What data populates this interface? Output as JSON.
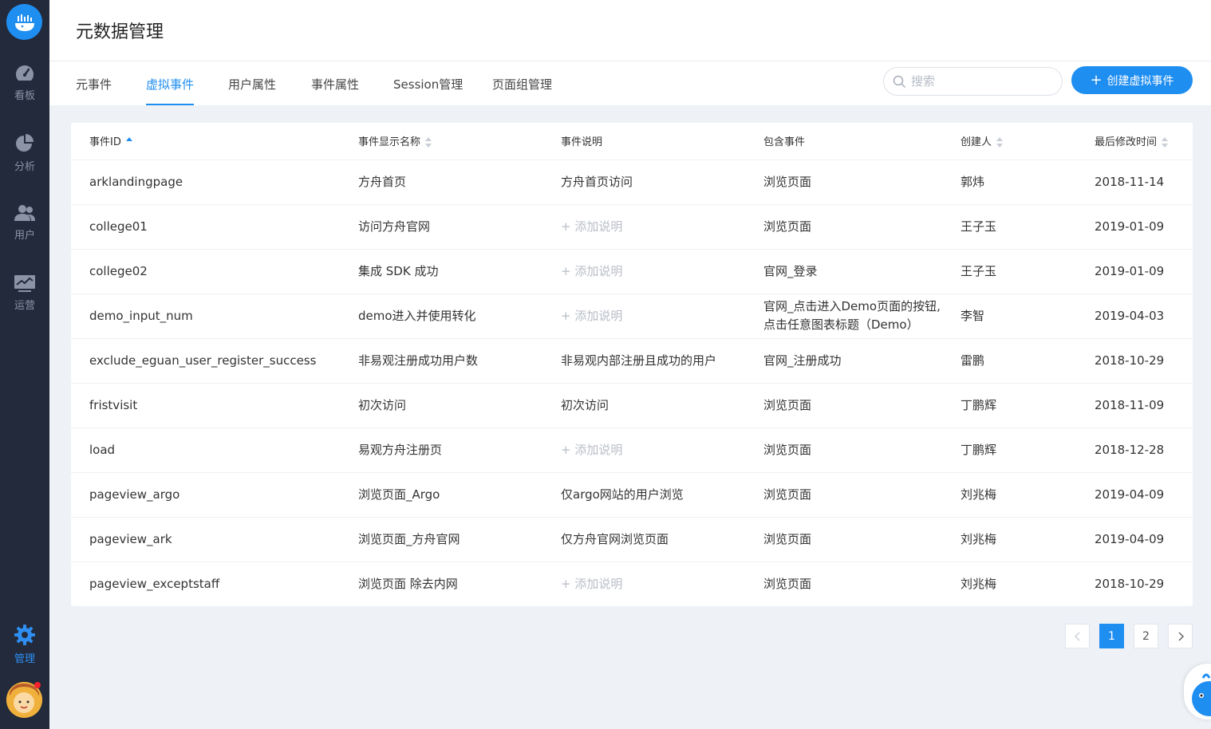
{
  "sidebar": {
    "items": [
      {
        "label": "看板",
        "icon": "dashboard-icon"
      },
      {
        "label": "分析",
        "icon": "pie-chart-icon"
      },
      {
        "label": "用户",
        "icon": "users-icon"
      },
      {
        "label": "运营",
        "icon": "monitor-icon"
      }
    ],
    "manage": {
      "label": "管理",
      "icon": "gear-icon"
    }
  },
  "header": {
    "title": "元数据管理"
  },
  "tabs": [
    {
      "label": "元事件"
    },
    {
      "label": "虚拟事件"
    },
    {
      "label": "用户属性"
    },
    {
      "label": "事件属性"
    },
    {
      "label": "Session管理"
    },
    {
      "label": "页面组管理"
    }
  ],
  "active_tab": "虚拟事件",
  "search": {
    "placeholder": "搜索",
    "value": ""
  },
  "create_button": {
    "label": "创建虚拟事件"
  },
  "table": {
    "columns": [
      {
        "label": "事件ID",
        "sort": "asc"
      },
      {
        "label": "事件显示名称",
        "sort": "none"
      },
      {
        "label": "事件说明"
      },
      {
        "label": "包含事件"
      },
      {
        "label": "创建人",
        "sort": "none"
      },
      {
        "label": "最后修改时间",
        "sort": "none"
      }
    ],
    "add_desc_label": "+ 添加说明",
    "rows": [
      {
        "id": "arklandingpage",
        "name": "方舟首页",
        "desc": "方舟首页访问",
        "events": "浏览页面",
        "creator": "郭炜",
        "modified": "2018-11-14"
      },
      {
        "id": "college01",
        "name": "访问方舟官网",
        "desc": "",
        "events": "浏览页面",
        "creator": "王子玉",
        "modified": "2019-01-09"
      },
      {
        "id": "college02",
        "name": "集成 SDK 成功",
        "desc": "",
        "events": "官网_登录",
        "creator": "王子玉",
        "modified": "2019-01-09"
      },
      {
        "id": "demo_input_num",
        "name": "demo进入并使用转化",
        "desc": "",
        "events": "官网_点击进入Demo页面的按钮,点击任意图表标题（Demo）",
        "creator": "李智",
        "modified": "2019-04-03"
      },
      {
        "id": "exclude_eguan_user_register_success",
        "name": "非易观注册成功用户数",
        "desc": "非易观内部注册且成功的用户",
        "events": "官网_注册成功",
        "creator": "雷鹏",
        "modified": "2018-10-29"
      },
      {
        "id": "fristvisit",
        "name": "初次访问",
        "desc": "初次访问",
        "events": "浏览页面",
        "creator": "丁鹏辉",
        "modified": "2018-11-09"
      },
      {
        "id": "load",
        "name": "易观方舟注册页",
        "desc": "",
        "events": "浏览页面",
        "creator": "丁鹏辉",
        "modified": "2018-12-28"
      },
      {
        "id": "pageview_argo",
        "name": "浏览页面_Argo",
        "desc": "仅argo网站的用户浏览",
        "events": "浏览页面",
        "creator": "刘兆梅",
        "modified": "2019-04-09"
      },
      {
        "id": "pageview_ark",
        "name": "浏览页面_方舟官网",
        "desc": "仅方舟官网浏览页面",
        "events": "浏览页面",
        "creator": "刘兆梅",
        "modified": "2019-04-09"
      },
      {
        "id": "pageview_exceptstaff",
        "name": "浏览页面 除去内网",
        "desc": "",
        "events": "浏览页面",
        "creator": "刘兆梅",
        "modified": "2018-10-29"
      }
    ]
  },
  "pagination": {
    "pages": [
      "1",
      "2"
    ],
    "current": "1"
  },
  "colors": {
    "accent": "#1f8ef1",
    "sidebar": "#232a3b",
    "background": "#eef2f7"
  }
}
